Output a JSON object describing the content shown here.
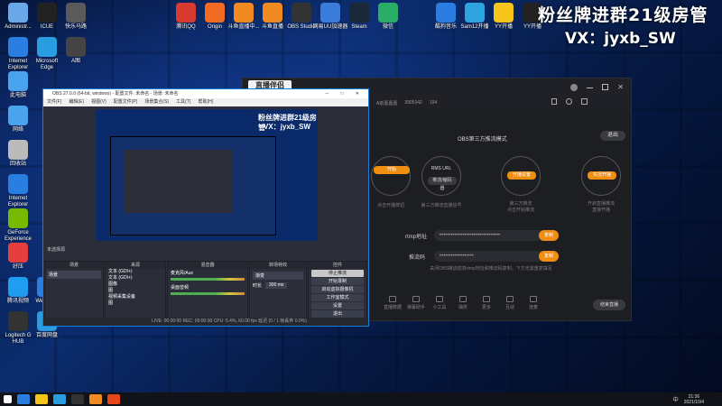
{
  "desktop_icons": [
    {
      "label": "Administr...",
      "x": 0,
      "y": 0,
      "c": "#6aa7e8"
    },
    {
      "label": "ICUE",
      "x": 1,
      "y": 0,
      "c": "#222"
    },
    {
      "label": "快乐马路",
      "x": 2,
      "y": 0,
      "c": "#5a5a5a"
    },
    {
      "label": "腾讯QQ",
      "x": 5,
      "y": 0,
      "c": "#d93a2f"
    },
    {
      "label": "Origin",
      "x": 6,
      "y": 0,
      "c": "#f26b22"
    },
    {
      "label": "斗鱼直播中...",
      "x": 7,
      "y": 0,
      "c": "#f28a22"
    },
    {
      "label": "斗鱼直播",
      "x": 8,
      "y": 0,
      "c": "#f28a22"
    },
    {
      "label": "OBS Studio",
      "x": 9,
      "y": 0,
      "c": "#333"
    },
    {
      "label": "网易UU加速器",
      "x": 10,
      "y": 0,
      "c": "#3b7bd9"
    },
    {
      "label": "Steam",
      "x": 11,
      "y": 0,
      "c": "#1b2838"
    },
    {
      "label": "微信",
      "x": 12,
      "y": 0,
      "c": "#2aae67"
    },
    {
      "label": "酷狗音乐",
      "x": 14,
      "y": 0,
      "c": "#2a7de1"
    },
    {
      "label": "Sam12开播",
      "x": 15,
      "y": 0,
      "c": "#2da3e0"
    },
    {
      "label": "YY开播",
      "x": 16,
      "y": 0,
      "c": "#f5c518"
    },
    {
      "label": "YY开播",
      "x": 17,
      "y": 0,
      "c": "#222"
    },
    {
      "label": "Internet Explorer",
      "x": 0,
      "y": 1,
      "c": "#2a7de1"
    },
    {
      "label": "Microsoft Edge",
      "x": 1,
      "y": 1,
      "c": "#2a9de1"
    },
    {
      "label": "A图",
      "x": 2,
      "y": 1,
      "c": "#444"
    },
    {
      "label": "此电脑",
      "x": 0,
      "y": 2,
      "c": "#4aa3ef"
    },
    {
      "label": "网络",
      "x": 0,
      "y": 3,
      "c": "#4aa3ef"
    },
    {
      "label": "回收站",
      "x": 0,
      "y": 4,
      "c": "#bbb"
    },
    {
      "label": "Internet Explorer",
      "x": 0,
      "y": 5,
      "c": "#2a7de1"
    },
    {
      "label": "GeForce Experience",
      "x": 0,
      "y": 6,
      "c": "#76b900"
    },
    {
      "label": "好压",
      "x": 0,
      "y": 7,
      "c": "#e63e3e"
    },
    {
      "label": "腾讯视频",
      "x": 0,
      "y": 8,
      "c": "#1f9df0"
    },
    {
      "label": "Logitech G HUB",
      "x": 0,
      "y": 9,
      "c": "#333"
    },
    {
      "label": "WeGame",
      "x": 1,
      "y": 8,
      "c": "#2a7de1"
    },
    {
      "label": "百度网盘",
      "x": 1,
      "y": 9,
      "c": "#2a9de1"
    }
  ],
  "banner": {
    "line1": "粉丝牌进群21级房管",
    "line2": "VX：jyxb_SW"
  },
  "zhibo": {
    "logo": "直播伴侣",
    "user_line": [
      "A前嘉嘉嘉",
      "3905342",
      "104"
    ],
    "mode_title": "OBS第三方推流模式",
    "exit_button": "退出",
    "steps": [
      {
        "num": "1",
        "title": "",
        "button": "开始",
        "caption": "点击开播按钮"
      },
      {
        "num": "2",
        "title": "RMS URL",
        "button": "推流/编码器",
        "caption": "第三方推流直播信号"
      },
      {
        "num": "3",
        "title": "",
        "button": "开播设置",
        "caption": "第三方推流\n点击开始推流"
      },
      {
        "num": "4",
        "title": "",
        "button": "实况开播",
        "caption": "开启直播推流\n直接开播"
      }
    ],
    "rtmp_label": "rtmp地址",
    "rtmp_value": "••••••••••••••••••••••••••••••••",
    "rtmp_copy": "复制",
    "key_label": "推流码",
    "key_value": "••••••••••••••••••",
    "key_copy": "复制",
    "note": "关闭OBS推流前将rtmp地址和推流码复制，下方无需重复填写",
    "tools": [
      "直播数据",
      "弹幕助手",
      "小工具",
      "抽奖",
      "更多",
      "互动",
      "连麦"
    ],
    "end_button": "结束直播"
  },
  "obs": {
    "title": "OBS 27.0.0 (64-bit, windows) - 配置文件: 未命名 - 场景: 未命名",
    "menu": [
      "文件(F)",
      "编辑(E)",
      "视图(V)",
      "配置文件(P)",
      "场景集合(S)",
      "工具(T)",
      "帮助(H)"
    ],
    "preview_overlay1": "粉丝牌进群21级房管",
    "preview_overlay2": "VX：jyxb_SW",
    "mixer_label": "未选择源",
    "docks": {
      "scenes": {
        "title": "场景",
        "items": [
          "场景"
        ]
      },
      "sources": {
        "title": "来源",
        "items": [
          "文本 (GDI+)",
          "文本 (GDI+)",
          "图像",
          "图",
          "视频采集设备",
          "图"
        ]
      },
      "mixer": {
        "title": "混音器",
        "tracks": [
          "麦克风/Aux",
          "桌面音频"
        ]
      },
      "transitions": {
        "title": "转场特效",
        "type": "渐变",
        "duration_label": "时长",
        "duration_value": "300 ms"
      },
      "controls": {
        "title": "控件",
        "buttons": [
          "停止推流",
          "开始录制",
          "启动虚拟摄像机",
          "工作室模式",
          "设置",
          "退出"
        ]
      }
    },
    "status": "LIVE: 00:00:00    REC: 00:00:00    CPU: 5.4%, 60.00 fps    延迟 (0 / 1 帧丢弃 0.0%)"
  },
  "taskbar": {
    "time": "21:36",
    "date": "2021/10/4",
    "lang": "中"
  }
}
